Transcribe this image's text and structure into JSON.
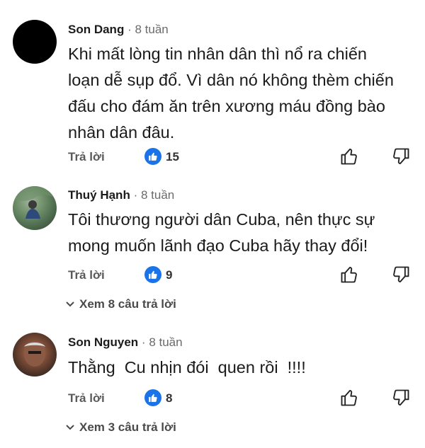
{
  "comments": [
    {
      "author": "Son Dang",
      "separator": "·",
      "time": "8 tuần",
      "avatar": "avatar-black",
      "text_lines": [
        "Khi mất lòng tin nhân dân thì nổ ra chiến",
        "loạn dễ sụp đổ. Vì dân nó không thèm chiến",
        "đấu cho đám ăn trên xương máu đồng bào",
        "nhân dân đâu."
      ],
      "reply_label": "Trả lời",
      "likes": "15",
      "view_replies": ""
    },
    {
      "author": "Thuý Hạnh",
      "separator": "·",
      "time": "8 tuần",
      "avatar": "avatar-photo",
      "text_lines": [
        "Tôi thương người dân Cuba, nên thực sự",
        "mong muốn lãnh đạo Cuba hãy thay đổi!"
      ],
      "reply_label": "Trả lời",
      "likes": "9",
      "view_replies": "Xem 8 câu trả lời"
    },
    {
      "author": "Son Nguyen",
      "separator": "·",
      "time": "8 tuần",
      "avatar": "avatar-photo",
      "text_lines": [
        "Thằng  Cu nhịn đói  quen rồi  !!!!"
      ],
      "reply_label": "Trả lời",
      "likes": "8",
      "view_replies": "Xem 3 câu trả lời"
    }
  ],
  "icons": {
    "like_badge": "thumbs-up-filled-icon",
    "like_button": "thumbs-up-outline-icon",
    "dislike_button": "thumbs-down-outline-icon",
    "expand": "chevron-down-icon"
  },
  "colors": {
    "like_badge": "#1a73e8",
    "text": "#1b1b1b",
    "secondary": "#6b6b6b"
  }
}
